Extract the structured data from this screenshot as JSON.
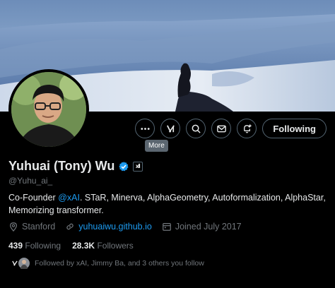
{
  "profile": {
    "name": "Yuhuai (Tony) Wu",
    "handle": "@Yuhu_ai_",
    "affiliation_badge": "x̸I",
    "bio_prefix": "Co-Founder ",
    "bio_mention": "@xAI",
    "bio_suffix": ". STaR, Minerva, AlphaGeometry, Autoformalization, AlphaStar, Memorizing transformer.",
    "location": "Stanford",
    "website": "yuhuaiwu.github.io",
    "joined": "Joined July 2017"
  },
  "stats": {
    "following_count": "439",
    "following_label": "Following",
    "followers_count": "28.3K",
    "followers_label": "Followers"
  },
  "actions": {
    "more_icon": "more-icon",
    "grok_icon": "grok-icon",
    "search_icon": "search-icon",
    "message_icon": "mail-icon",
    "notify_icon": "bell-plus-icon",
    "follow_label": "Following",
    "tooltip": "More"
  },
  "followed_by": {
    "text": "Followed by xAI, Jimmy Ba, and 3 others you follow"
  },
  "colors": {
    "accent": "#1d9bf0",
    "background": "#000000",
    "text": "#e7e9ea",
    "muted": "#71767b"
  }
}
